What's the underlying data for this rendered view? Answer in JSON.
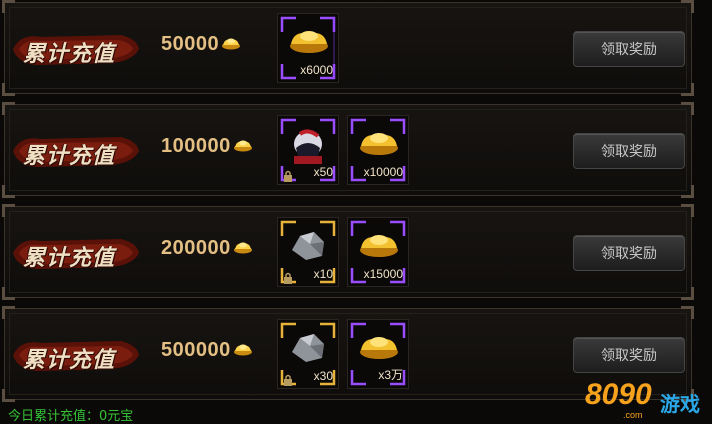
{
  "rows": [
    {
      "label": "累计充值",
      "amount": "50000",
      "items": [
        {
          "icon": "gold-ingot-icon",
          "count": "x6000",
          "frame": "purple",
          "locked": false
        }
      ],
      "button": "领取奖励"
    },
    {
      "label": "累计充值",
      "amount": "100000",
      "items": [
        {
          "icon": "helmet-icon",
          "count": "x50",
          "frame": "purple",
          "locked": true
        },
        {
          "icon": "gold-ingot-icon",
          "count": "x10000",
          "frame": "purple",
          "locked": false
        }
      ],
      "button": "领取奖励"
    },
    {
      "label": "累计充值",
      "amount": "200000",
      "items": [
        {
          "icon": "ore-icon",
          "count": "x10",
          "frame": "gold",
          "locked": true
        },
        {
          "icon": "gold-ingot-icon",
          "count": "x15000",
          "frame": "purple",
          "locked": false
        }
      ],
      "button": "领取奖励"
    },
    {
      "label": "累计充值",
      "amount": "500000",
      "items": [
        {
          "icon": "ore-icon",
          "count": "x30",
          "frame": "gold",
          "locked": true
        },
        {
          "icon": "gold-ingot-icon",
          "count": "x3万",
          "frame": "purple",
          "locked": false
        }
      ],
      "button": "领取奖励"
    }
  ],
  "footer": {
    "today_recharge": "今日累计充值：0元宝"
  },
  "logo": {
    "brand": "8090",
    "suffix": "游戏",
    "domain": ".com"
  },
  "colors": {
    "purple_frame": "#8a3cff",
    "gold_frame": "#e6b23a",
    "amount": "#e3bf84",
    "footer": "#35c235"
  }
}
